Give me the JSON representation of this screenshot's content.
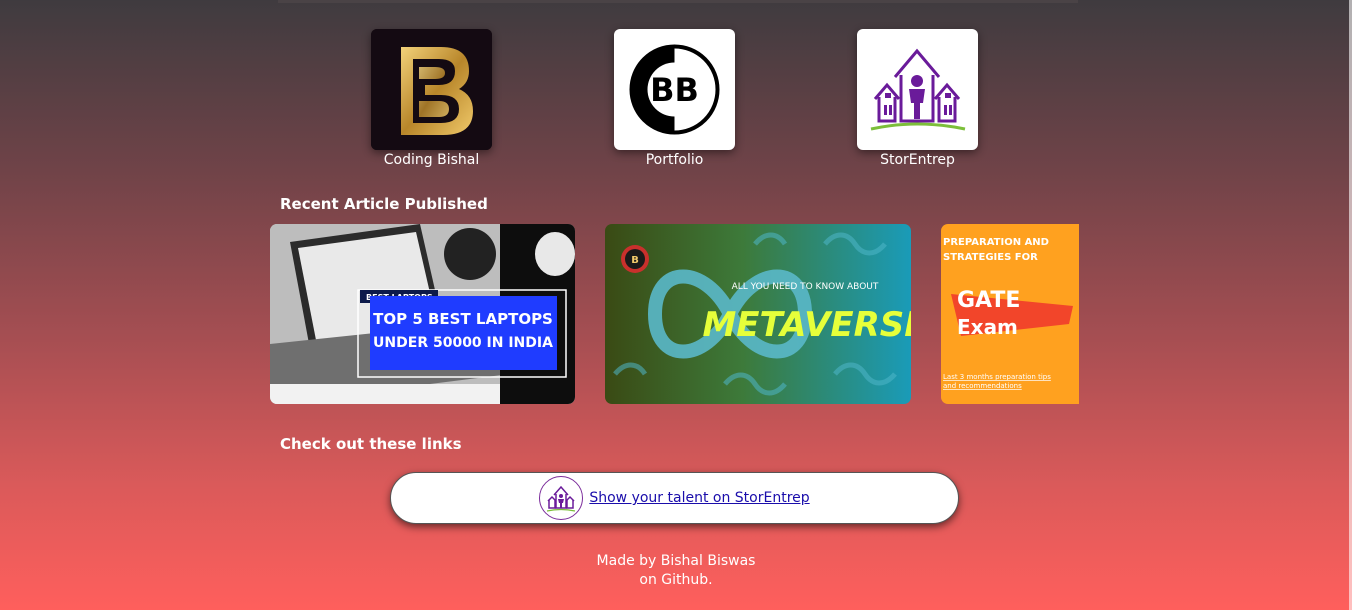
{
  "profiles": [
    {
      "label": "Coding Bishal",
      "logo_text": "B"
    },
    {
      "label": "Portfolio",
      "logo_text": "BB"
    },
    {
      "label": "StorEntrep"
    }
  ],
  "recent_articles": {
    "title": "Recent Article Published",
    "items": [
      {
        "tag": "BEST LAPTOPS",
        "line1": "TOP 5 BEST LAPTOPS",
        "line2": "UNDER 50000 IN INDIA"
      },
      {
        "pre": "ALL YOU NEED TO KNOW ABOUT",
        "headline": "METAVERSE"
      },
      {
        "pre1": "PREPARATION AND",
        "pre2": "STRATEGIES FOR",
        "title1": "GATE",
        "title2": "Exam",
        "sub1": "Last 3 months preparation tips",
        "sub2": "and recommendations"
      }
    ]
  },
  "links_section": {
    "title": "Check out these links",
    "link_text": "Show your talent on StorEntrep"
  },
  "footer": {
    "line1": "Made by Bishal Biswas",
    "line2": "on Github."
  },
  "colors": {
    "accent_purple": "#6a1b9a",
    "gold": "#d4a43a",
    "metaverse_yellow": "#e6ff3a",
    "gate_orange": "#ffa11f"
  }
}
